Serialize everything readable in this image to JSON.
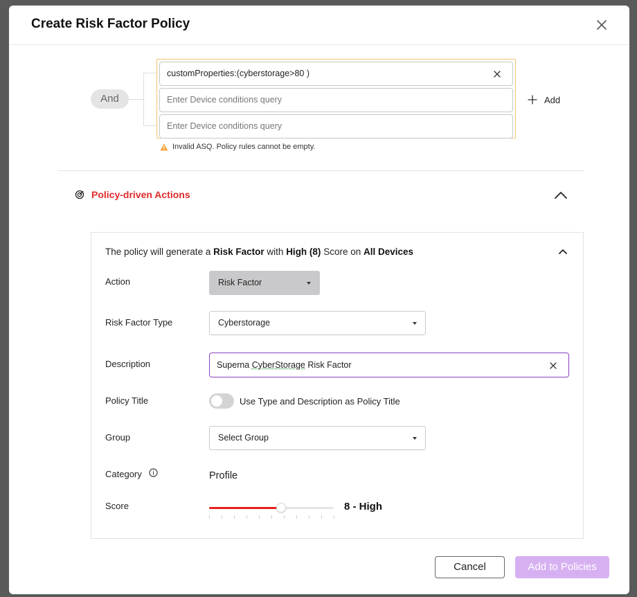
{
  "modal": {
    "title": "Create Risk Factor Policy"
  },
  "query": {
    "operator": "And",
    "rules": [
      {
        "value": "customProperties:(cyberstorage>80 )",
        "placeholder": ""
      },
      {
        "value": "",
        "placeholder": "Enter Device conditions query"
      },
      {
        "value": "",
        "placeholder": "Enter Device conditions query"
      }
    ],
    "add_label": "Add",
    "error": "Invalid ASQ. Policy rules cannot be empty."
  },
  "actions_section": {
    "title": "Policy-driven Actions",
    "summary": {
      "prefix": "The policy will generate a",
      "action": "Risk Factor",
      "with": "with",
      "score": "High (8)",
      "score_on": "Score on",
      "target": "All Devices"
    },
    "fields": {
      "action_label": "Action",
      "action_value": "Risk Factor",
      "type_label": "Risk Factor Type",
      "type_value": "Cyberstorage",
      "description_label": "Description",
      "description_pre": "Superna ",
      "description_flagged": "CyberStorage",
      "description_post": " Risk Factor",
      "title_label": "Policy Title",
      "title_toggle_label": "Use Type and Description as Policy Title",
      "title_toggle_on": false,
      "group_label": "Group",
      "group_value": "Select Group",
      "category_label": "Category",
      "category_value": "Profile",
      "score_label": "Score",
      "score_value": 8,
      "score_max": 10,
      "score_text": "8 - High"
    }
  },
  "footer": {
    "cancel_label": "Cancel",
    "submit_label": "Add to Policies"
  },
  "colors": {
    "accent_red": "#e02a2a",
    "focus_purple": "#8b3fbf",
    "primary_disabled": "#d7b0f2",
    "warning": "#f2a33a"
  }
}
